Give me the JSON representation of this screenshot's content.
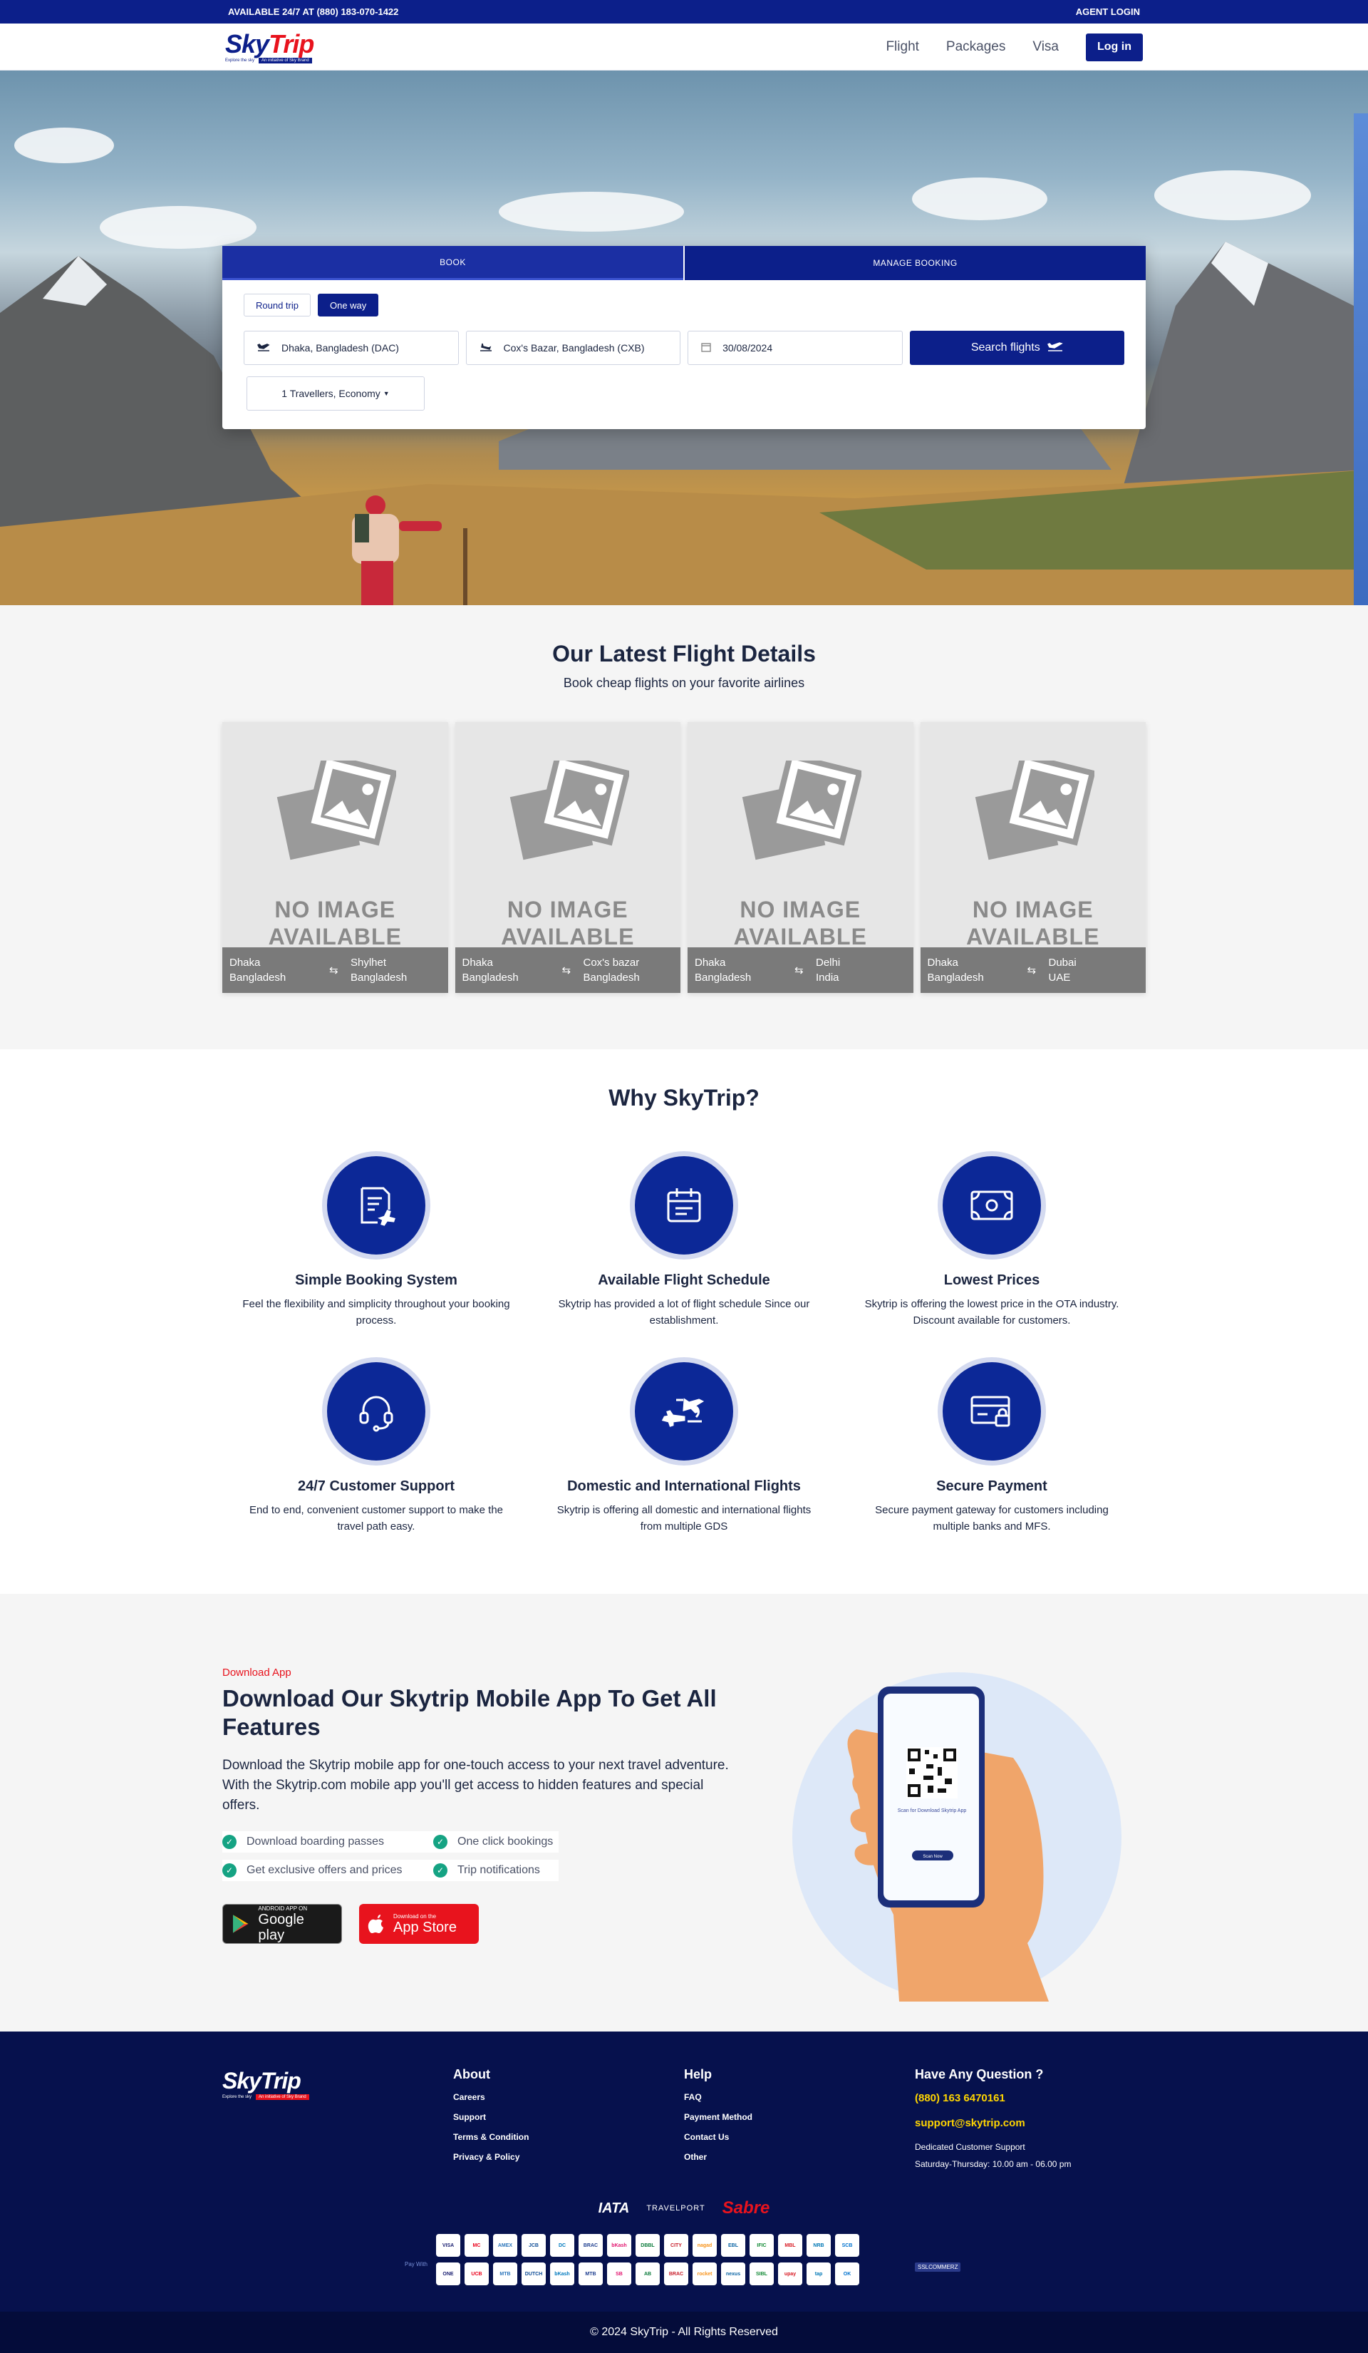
{
  "topbar": {
    "left": "AVAILABLE 24/7 AT (880) 183-070-1422",
    "right": "AGENT LOGIN"
  },
  "brand": {
    "sky": "Sky",
    "trip": "Trip",
    "tagline": "Explore the sky",
    "badge": "An initiative of Sky Brand"
  },
  "nav": {
    "links": [
      "Flight",
      "Packages",
      "Visa"
    ],
    "login": "Log in"
  },
  "search": {
    "tabs": [
      "BOOK",
      "MANAGE BOOKING"
    ],
    "trip_types": [
      "Round trip",
      "One way"
    ],
    "from": "Dhaka, Bangladesh (DAC)",
    "to": "Cox's Bazar, Bangladesh (CXB)",
    "date": "30/08/2024",
    "button": "Search flights",
    "travellers": "1 Travellers, Economy"
  },
  "latest": {
    "title": "Our Latest Flight Details",
    "subtitle": "Book cheap flights on your favorite airlines",
    "no_image": "NO IMAGE AVAILABLE",
    "cards": [
      {
        "from_city": "Dhaka",
        "from_country": "Bangladesh",
        "to_city": "Shylhet",
        "to_country": "Bangladesh"
      },
      {
        "from_city": "Dhaka",
        "from_country": "Bangladesh",
        "to_city": "Cox's bazar",
        "to_country": "Bangladesh"
      },
      {
        "from_city": "Dhaka",
        "from_country": "Bangladesh",
        "to_city": "Delhi",
        "to_country": "India"
      },
      {
        "from_city": "Dhaka",
        "from_country": "Bangladesh",
        "to_city": "Dubai",
        "to_country": "UAE"
      }
    ]
  },
  "why": {
    "title": "Why SkyTrip?",
    "features": [
      {
        "icon": "booking-icon",
        "title": "Simple Booking System",
        "desc": "Feel the flexibility and simplicity throughout your booking process."
      },
      {
        "icon": "calendar-icon",
        "title": "Available Flight Schedule",
        "desc": "Skytrip has provided a lot of flight schedule Since our establishment."
      },
      {
        "icon": "money-icon",
        "title": "Lowest Prices",
        "desc": "Skytrip is offering the lowest price in the OTA industry. Discount available for customers."
      },
      {
        "icon": "headset-icon",
        "title": "24/7 Customer Support",
        "desc": "End to end, convenient customer support to make the travel path easy."
      },
      {
        "icon": "planes-icon",
        "title": "Domestic and International Flights",
        "desc": "Skytrip is offering all domestic and international flights from multiple GDS"
      },
      {
        "icon": "card-lock-icon",
        "title": "Secure Payment",
        "desc": "Secure payment gateway for customers including multiple banks and MFS."
      }
    ]
  },
  "app": {
    "kicker": "Download App",
    "title": "Download Our Skytrip Mobile App To Get All Features",
    "desc": "Download the Skytrip mobile app for one-touch access to your next travel adventure. With the Skytrip.com mobile app you'll get access to hidden features and special offers.",
    "checks": [
      "Download boarding passes",
      "One click bookings",
      "Get exclusive offers and prices",
      "Trip notifications"
    ],
    "google_small": "ANDROID APP ON",
    "google_big": "Google play",
    "apple_small": "Download on the",
    "apple_big": "App Store",
    "phone_text": "Scan for Download Skytrip App",
    "phone_button": "Scan Now"
  },
  "footer": {
    "about_title": "About",
    "about_links": [
      "Careers",
      "Support",
      "Terms & Condition",
      "Privacy & Policy"
    ],
    "help_title": "Help",
    "help_links": [
      "FAQ",
      "Payment Method",
      "Contact Us",
      "Other"
    ],
    "question_title": "Have Any Question ?",
    "phone": "(880) 163 6470161",
    "email": "support@skytrip.com",
    "support_label": "Dedicated Customer Support",
    "support_hours": "Saturday-Thursday: 10.00 am - 06.00 pm",
    "partners": [
      "IATA",
      "TRAVELPORT",
      "Sabre"
    ],
    "pay_label": "Pay With",
    "payments": [
      "VISA",
      "MC",
      "AMEX",
      "JCB",
      "DC",
      "BRAC",
      "bKash",
      "DBBL",
      "CITY",
      "nagad",
      "EBL",
      "IFIC",
      "MBL",
      "NRB",
      "SCB",
      "ONE",
      "UCB",
      "MTB",
      "DUTCH",
      "bKash",
      "MTB",
      "SB",
      "AB",
      "BRAC",
      "rocket",
      "nexus",
      "SIBL",
      "upay",
      "tap",
      "OK"
    ],
    "ssl": "SSLCOMMERZ",
    "copyright": "© 2024 SkyTrip - All Rights Reserved"
  }
}
